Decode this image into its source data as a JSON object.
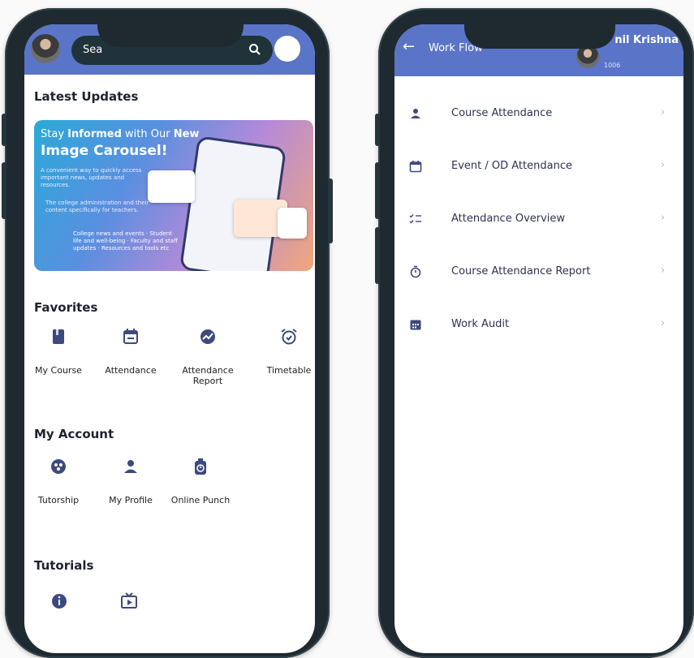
{
  "left_screen": {
    "search": {
      "placeholder": "Sea"
    },
    "latest_updates": {
      "title": "Latest Updates",
      "banner": {
        "line1_pre": "Stay ",
        "line1_bold": "Informed",
        "line1_mid": " with Our ",
        "line1_new": "New",
        "line2": "Image Carousel!",
        "line3": "A convenient way to quickly access important news, updates and resources.",
        "line4": "The college administration and their content specifically for teachers.",
        "line5": "College news and events · Student life and well-being · Faculty and staff updates · Resources and tools etc"
      }
    },
    "favorites": {
      "title": "Favorites",
      "items": [
        {
          "label": "My Course",
          "icon": "book-icon"
        },
        {
          "label": "Attendance",
          "icon": "calendar-icon"
        },
        {
          "label": "Attendance Report",
          "icon": "chart-icon"
        },
        {
          "label": "Timetable",
          "icon": "alarm-clock-icon"
        }
      ]
    },
    "my_account": {
      "title": "My Account",
      "items": [
        {
          "label": "Tutorship",
          "icon": "group-icon"
        },
        {
          "label": "My Profile",
          "icon": "person-icon"
        },
        {
          "label": "Online Punch",
          "icon": "punch-timer-icon"
        }
      ]
    },
    "tutorials": {
      "title": "Tutorials",
      "items": [
        {
          "icon": "info-icon"
        },
        {
          "icon": "tv-play-icon"
        }
      ]
    }
  },
  "right_screen": {
    "header": {
      "title": "Work Flow",
      "user_name": "nil Krishna",
      "user_id": "1006"
    },
    "menu": [
      {
        "label": "Course Attendance",
        "icon": "person-icon"
      },
      {
        "label": "Event / OD Attendance",
        "icon": "calendar-icon"
      },
      {
        "label": "Attendance Overview",
        "icon": "checklist-icon"
      },
      {
        "label": "Course Attendance Report",
        "icon": "stopwatch-icon"
      },
      {
        "label": "Work Audit",
        "icon": "calendar-grid-icon"
      }
    ]
  },
  "colors": {
    "accent": "#5a74c7",
    "icon": "#3c4a7d",
    "text": "#2c3450"
  }
}
